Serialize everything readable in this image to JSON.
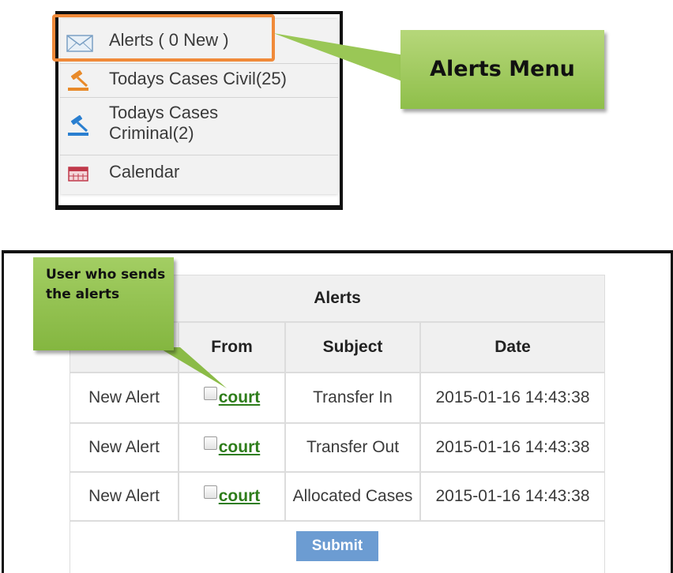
{
  "menu": {
    "items": [
      {
        "label": "Alerts ( 0 New  )",
        "icon": "mail-icon"
      },
      {
        "label": "Todays Cases Civil(25)",
        "icon": "gavel-icon"
      },
      {
        "label": "Todays Cases Criminal(2)",
        "icon": "gavel-icon"
      },
      {
        "label": "Calendar",
        "icon": "calendar-icon"
      }
    ]
  },
  "callouts": {
    "alerts_menu": "Alerts Menu",
    "user_who_sends": "User who sends the alerts"
  },
  "alerts_table": {
    "title": "Alerts",
    "columns": [
      "",
      "From",
      "Subject",
      "Date"
    ],
    "rows": [
      {
        "status": "New Alert",
        "from": "court",
        "subject": "Transfer In",
        "date": "2015-01-16 14:43:38"
      },
      {
        "status": "New Alert",
        "from": "court",
        "subject": "Transfer Out",
        "date": "2015-01-16 14:43:38"
      },
      {
        "status": "New Alert",
        "from": "court",
        "subject": "Allocated Cases",
        "date": "2015-01-16 14:43:38"
      }
    ],
    "submit_label": "Submit"
  },
  "colors": {
    "highlight": "#f08a3a",
    "callout_green": "#8fbf4a",
    "link_green": "#2e7d1a",
    "submit_blue": "#6c9cd2"
  }
}
